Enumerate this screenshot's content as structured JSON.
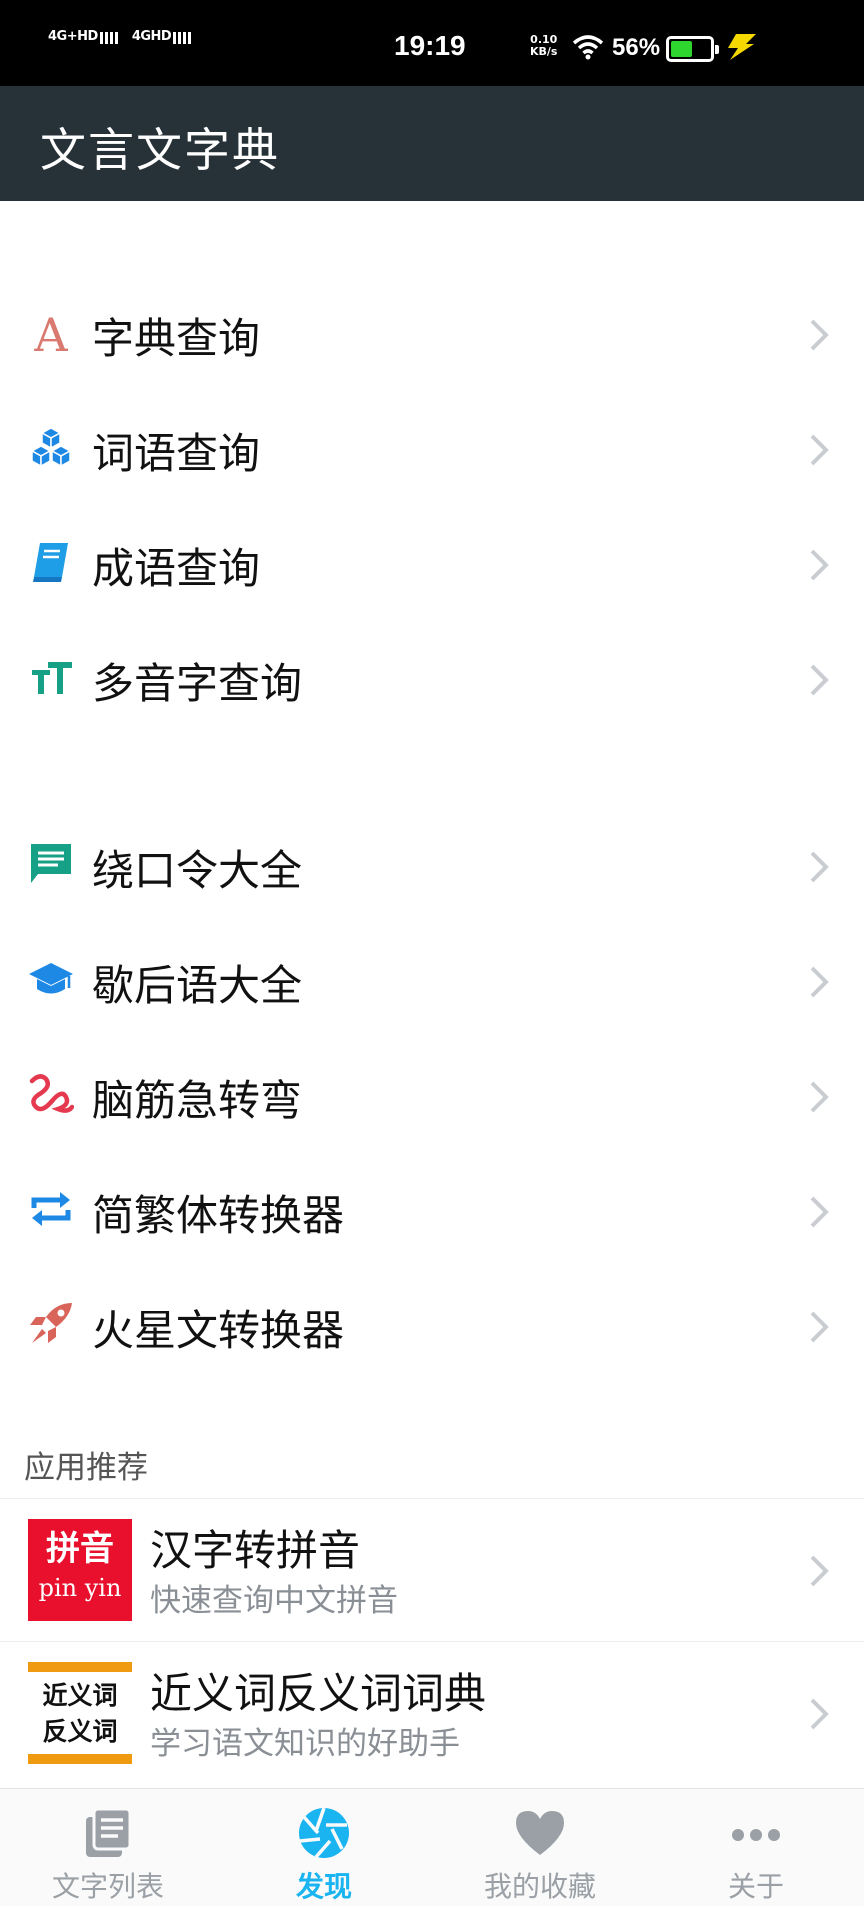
{
  "status_bar": {
    "network1": "4G+HD",
    "network2": "4GHD",
    "time": "19:19",
    "speed_value": "0.10",
    "speed_unit": "KB/s",
    "battery_percent": "56%",
    "battery_level": 0.56,
    "battery_color": "#2fd52f"
  },
  "header": {
    "title": "文言文字典"
  },
  "menu_group_1": [
    {
      "label": "字典查询",
      "icon": "letter-a-icon"
    },
    {
      "label": "词语查询",
      "icon": "cubes-icon"
    },
    {
      "label": "成语查询",
      "icon": "book-icon"
    },
    {
      "label": "多音字查询",
      "icon": "text-size-icon"
    }
  ],
  "menu_group_2": [
    {
      "label": "绕口令大全",
      "icon": "chat-icon"
    },
    {
      "label": "歇后语大全",
      "icon": "graduation-cap-icon"
    },
    {
      "label": "脑筋急转弯",
      "icon": "squiggle-icon"
    },
    {
      "label": "简繁体转换器",
      "icon": "swap-icon"
    },
    {
      "label": "火星文转换器",
      "icon": "rocket-icon"
    }
  ],
  "recommend": {
    "section_title": "应用推荐",
    "apps": [
      {
        "title": "汉字转拼音",
        "subtitle": "快速查询中文拼音",
        "logo_big": "拼音",
        "logo_small": "pin yin"
      },
      {
        "title": "近义词反义词词典",
        "subtitle": "学习语文知识的好助手",
        "logo_line1": "近义词",
        "logo_line2": "反义词"
      }
    ]
  },
  "bottom_nav": [
    {
      "label": "文字列表",
      "icon": "list-icon",
      "active": false
    },
    {
      "label": "发现",
      "icon": "aperture-icon",
      "active": true
    },
    {
      "label": "我的收藏",
      "icon": "heart-icon",
      "active": false
    },
    {
      "label": "关于",
      "icon": "more-icon",
      "active": false
    }
  ],
  "colors": {
    "header_bg": "#263238",
    "accent": "#1ab4f0",
    "nav_inactive": "#9aa0a6"
  }
}
